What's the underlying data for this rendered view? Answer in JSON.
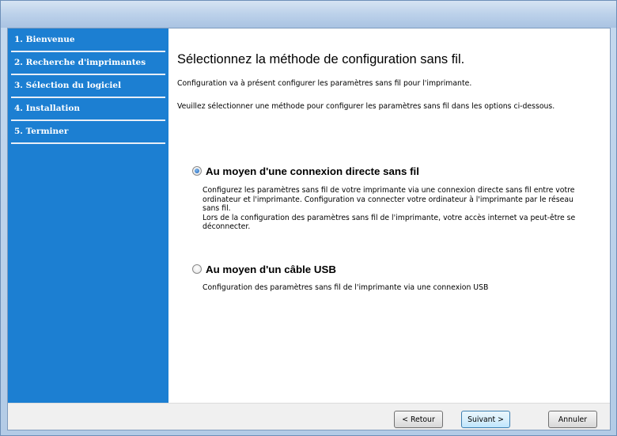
{
  "wizard": {
    "steps": [
      {
        "label": "1. Bienvenue"
      },
      {
        "label": "2. Recherche d'imprimantes"
      },
      {
        "label": "3. Sélection du logiciel"
      },
      {
        "label": "4. Installation"
      },
      {
        "label": "5. Terminer"
      }
    ],
    "current_step": 3
  },
  "main": {
    "title": "Sélectionnez la méthode de configuration sans fil.",
    "intro_1": "Configuration va à présent configurer les paramètres sans fil pour l'imprimante.",
    "intro_2": "Veuillez sélectionner une méthode pour configurer les paramètres sans fil dans les options ci-dessous.",
    "options": [
      {
        "label": "Au moyen d'une connexion directe sans fil",
        "selected": true,
        "desc_lines": [
          "Configurez les paramètres sans fil de votre imprimante via une connexion directe sans fil entre votre",
          "ordinateur et l'imprimante. Configuration va connecter votre ordinateur à l'imprimante par le réseau",
          "sans fil.",
          "Lors de la configuration des paramètres sans fil de l'imprimante, votre accès internet va peut-être se",
          "déconnecter."
        ]
      },
      {
        "label": "Au moyen d'un câble USB",
        "selected": false,
        "desc_lines": [
          "Configuration des paramètres sans fil de l'imprimante via une connexion USB"
        ]
      }
    ]
  },
  "footer": {
    "back_label": "< Retour",
    "next_label": "Suivant >",
    "cancel_label": "Annuler"
  }
}
